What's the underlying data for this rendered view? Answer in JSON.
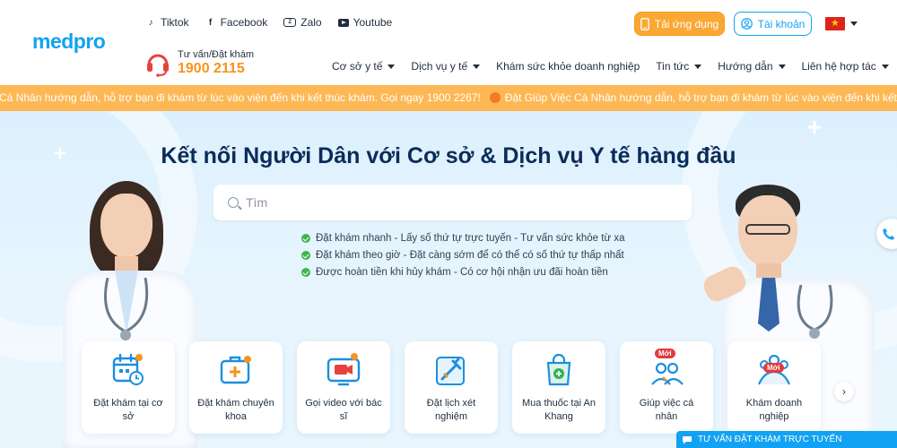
{
  "header": {
    "logo": "medpro",
    "social": [
      {
        "label": "Tiktok",
        "icon": "tiktok-icon"
      },
      {
        "label": "Facebook",
        "icon": "facebook-icon"
      },
      {
        "label": "Zalo",
        "icon": "zalo-icon"
      },
      {
        "label": "Youtube",
        "icon": "youtube-icon"
      }
    ],
    "hotline_label": "Tư vấn/Đặt khám",
    "hotline_number": "1900 2115",
    "app_button": "Tải ứng dụng",
    "account_button": "Tài khoản",
    "nav": [
      {
        "label": "Cơ sở y tế",
        "dropdown": true
      },
      {
        "label": "Dịch vụ y tế",
        "dropdown": true
      },
      {
        "label": "Khám sức khỏe doanh nghiệp",
        "dropdown": false
      },
      {
        "label": "Tin tức",
        "dropdown": true
      },
      {
        "label": "Hướng dẫn",
        "dropdown": true
      },
      {
        "label": "Liên hệ hợp tác",
        "dropdown": true
      }
    ]
  },
  "marquee": {
    "text_1": "Cá Nhân hướng dẫn, hỗ trợ bạn đi khám từ lúc vào viện đến khi kết thúc khám. Gọi ngay 1900 2267!",
    "text_2": "Đặt Giúp Việc Cá Nhân hướng dẫn, hỗ trợ bạn đi khám từ lúc vào viện đến khi kết thúc khám. Gọi n"
  },
  "hero": {
    "title": "Kết nối Người Dân với Cơ sở & Dịch vụ Y tế hàng đầu",
    "search_placeholder": "Tìm",
    "features": [
      "Đặt khám nhanh - Lấy số thứ tự trực tuyến - Tư vấn sức khỏe từ xa",
      "Đặt khám theo giờ - Đặt càng sớm để có thể có số thứ tự thấp nhất",
      "Được hoàn tiền khi hủy khám - Có cơ hội nhận ưu đãi hoàn tiền"
    ]
  },
  "services": [
    {
      "label": "Đặt khám tại cơ sở",
      "icon": "calendar-icon",
      "badge": ""
    },
    {
      "label": "Đặt khám chuyên khoa",
      "icon": "medical-kit-icon",
      "badge": ""
    },
    {
      "label": "Gọi video với bác sĩ",
      "icon": "video-call-icon",
      "badge": ""
    },
    {
      "label": "Đặt lịch xét nghiệm",
      "icon": "syringe-icon",
      "badge": ""
    },
    {
      "label": "Mua thuốc tại An Khang",
      "icon": "pharmacy-bag-icon",
      "badge": ""
    },
    {
      "label": "Giúp việc cá nhân",
      "icon": "helper-icon",
      "badge": "Mới"
    },
    {
      "label": "Khám doanh nghiệp",
      "icon": "business-group-icon",
      "badge": "Mới"
    }
  ],
  "consult_bar": "TƯ VẤN ĐẶT KHÁM TRỰC TUYẾN",
  "colors": {
    "brand_blue": "#11a2f3",
    "accent_orange": "#f7931e",
    "marquee_bg": "#fdb855",
    "title_navy": "#0b2c5a"
  }
}
